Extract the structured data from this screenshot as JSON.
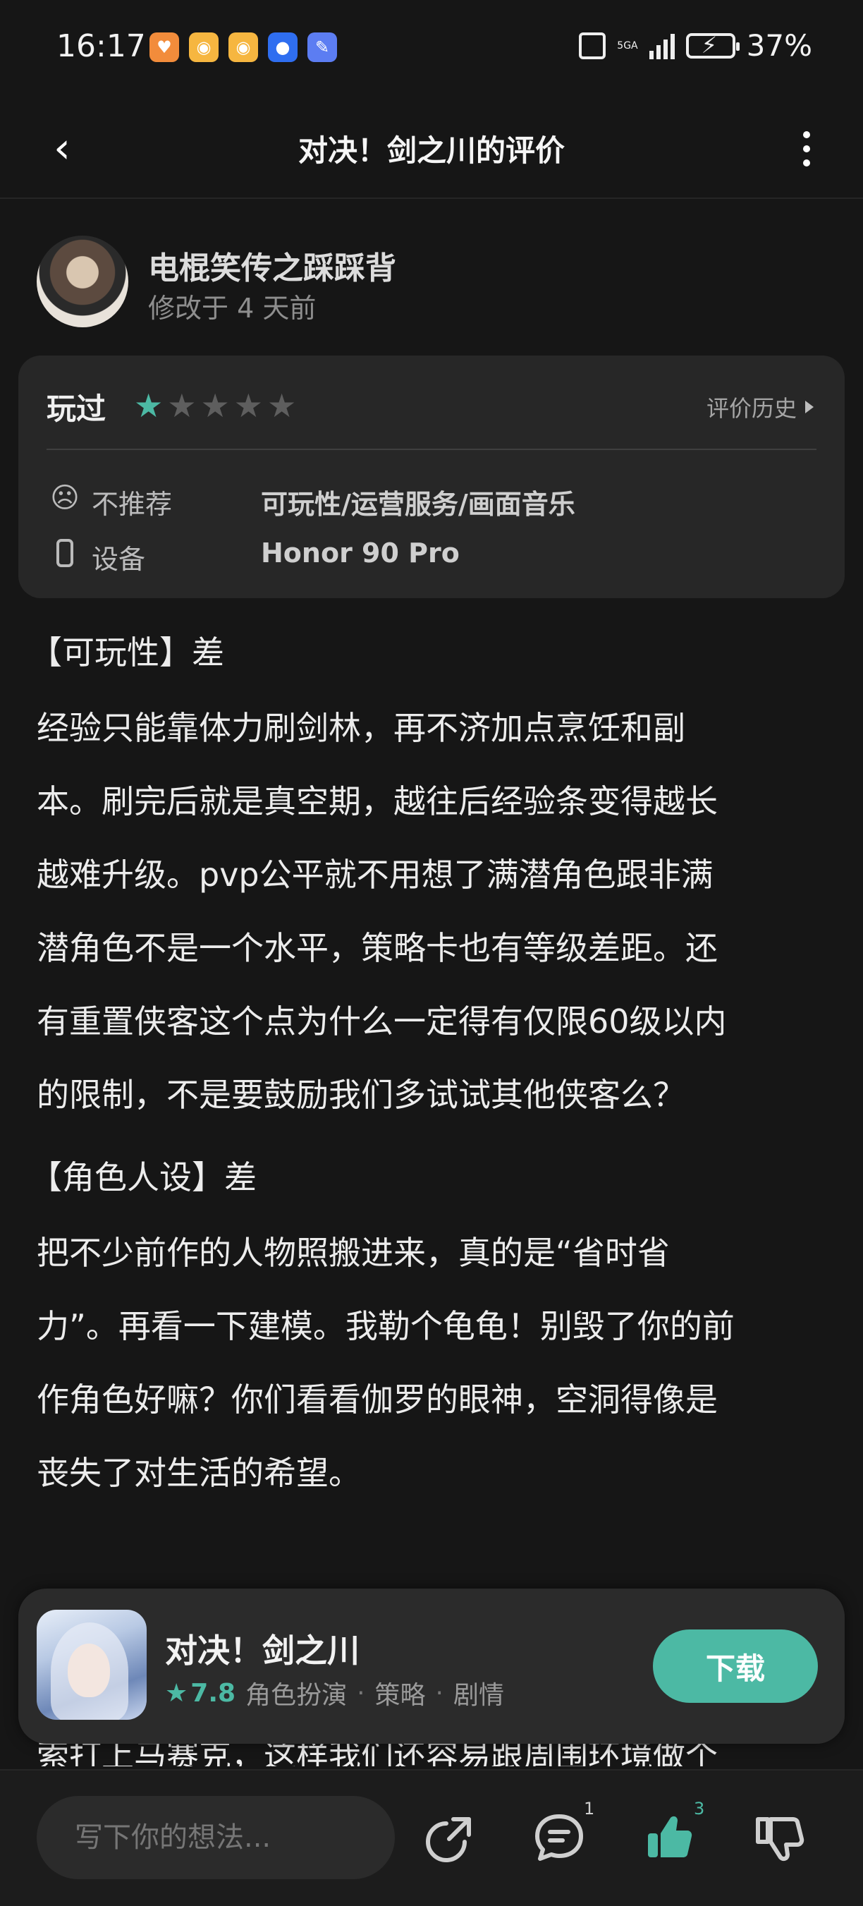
{
  "status_bar": {
    "time": "16:17",
    "network": "5GA",
    "battery": "37%"
  },
  "nav": {
    "title": "对决！剑之川的评价"
  },
  "review": {
    "username": "电棍笑传之踩踩背",
    "modified": "修改于 4 天前",
    "played_label": "玩过",
    "rating": 1,
    "rating_max": 5,
    "history_label": "评价历史",
    "not_recommend_label": "不推荐",
    "not_recommend_value": "可玩性/运营服务/画面音乐",
    "device_label": "设备",
    "device_value": "Honor 90 Pro"
  },
  "body": {
    "h1": "【可玩性】差",
    "p1_lines": [
      "经验只能靠体力刷剑林，再不济加点烹饪和副",
      "本。刷完后就是真空期，越往后经验条变得越长",
      "越难升级。pvp公平就不用想了满潜角色跟非满",
      "潜角色不是一个水平，策略卡也有等级差距。还",
      "有重置侠客这个点为什么一定得有仅限60级以内",
      "的限制，不是要鼓励我们多试试其他侠客么？"
    ],
    "h2": "【角色人设】差",
    "p2_lines": [
      "把不少前作的人物照搬进来，真的是“省时省",
      "力”。再看一下建模。我勒个龟龟！别毁了你的前",
      "作角色好嘛？你们看看伽罗的眼神，空洞得像是",
      "丧失了对生活的希望。"
    ],
    "cut_line": "索打上马赛克，这样我们还容易跟周围环境做个"
  },
  "game_card": {
    "name": "对决！剑之川",
    "score": "7.8",
    "tags": [
      "角色扮演",
      "策略",
      "剧情"
    ],
    "download_label": "下载"
  },
  "bottom_bar": {
    "input_placeholder": "写下你的想法...",
    "comment_count": "1",
    "like_count": "3"
  },
  "colors": {
    "accent": "#4cb9a4",
    "background": "#161616",
    "card": "#272727"
  }
}
